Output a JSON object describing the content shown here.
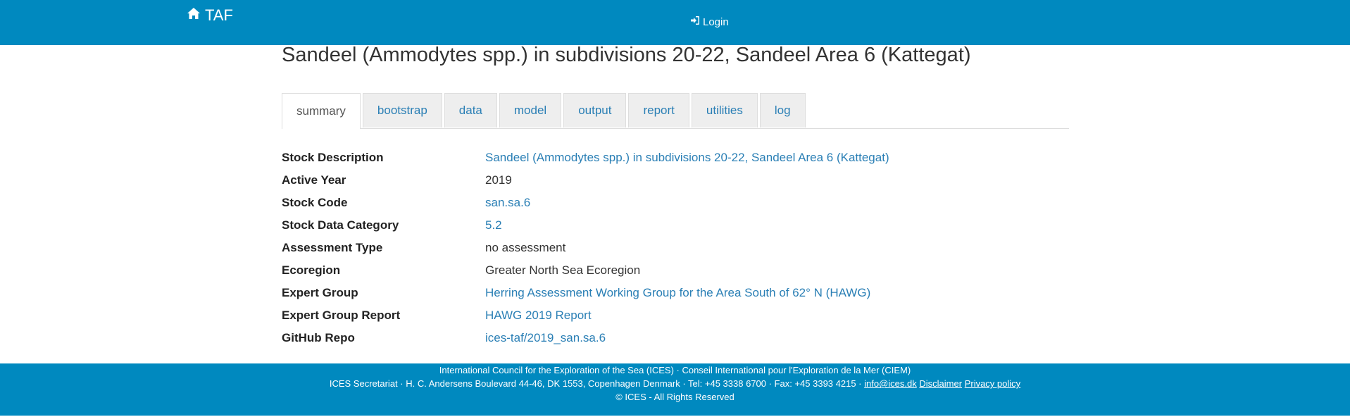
{
  "navbar": {
    "brand": "TAF",
    "login": "Login",
    "color": "#0089bf"
  },
  "page": {
    "title": "Sandeel (Ammodytes spp.) in subdivisions 20-22, Sandeel Area 6 (Kattegat)"
  },
  "tabs": [
    {
      "label": "summary",
      "active": true
    },
    {
      "label": "bootstrap",
      "active": false
    },
    {
      "label": "data",
      "active": false
    },
    {
      "label": "model",
      "active": false
    },
    {
      "label": "output",
      "active": false
    },
    {
      "label": "report",
      "active": false
    },
    {
      "label": "utilities",
      "active": false
    },
    {
      "label": "log",
      "active": false
    }
  ],
  "summary": [
    {
      "label": "Stock Description",
      "value": "Sandeel (Ammodytes spp.) in subdivisions 20-22, Sandeel Area 6 (Kattegat)",
      "link": true
    },
    {
      "label": "Active Year",
      "value": "2019",
      "link": false
    },
    {
      "label": "Stock Code",
      "value": "san.sa.6",
      "link": true
    },
    {
      "label": "Stock Data Category",
      "value": "5.2",
      "link": true
    },
    {
      "label": "Assessment Type",
      "value": "no assessment",
      "link": false
    },
    {
      "label": "Ecoregion",
      "value": "Greater North Sea Ecoregion",
      "link": false
    },
    {
      "label": "Expert Group",
      "value": "Herring Assessment Working Group for the Area South of 62° N (HAWG)",
      "link": true
    },
    {
      "label": "Expert Group Report",
      "value": "HAWG 2019 Report",
      "link": true
    },
    {
      "label": "GitHub Repo",
      "value": "ices-taf/2019_san.sa.6",
      "link": true
    }
  ],
  "footer": {
    "line1": "International Council for the Exploration of the Sea (ICES) · Conseil International pour l'Exploration de la Mer (CIEM)",
    "line2_text": "ICES Secretariat · H. C. Andersens Boulevard 44-46, DK 1553, Copenhagen Denmark · Tel: +45 3338 6700 · Fax: +45 3393 4215 ·",
    "email": "info@ices.dk",
    "disclaimer": "Disclaimer",
    "privacy": "Privacy policy",
    "line3": "© ICES - All Rights Reserved"
  },
  "icons": {
    "brand": "home-icon",
    "login": "sign-in-icon"
  }
}
